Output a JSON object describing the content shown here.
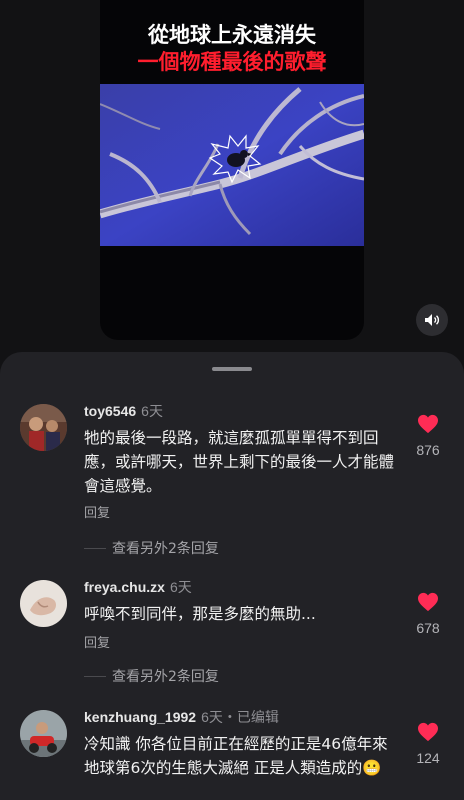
{
  "video": {
    "title_line1": "從地球上永遠消失",
    "title_line2": "一個物種最後的歌聲",
    "title_line2_color": "#ff1e2e",
    "mute_icon": "speaker-mute-icon"
  },
  "comments": [
    {
      "username": "toy6546",
      "time": "6天",
      "text": "牠的最後一段路，就這麼孤孤單單得不到回應，或許哪天，世界上剩下的最後一人才能體會這感覺。",
      "reply_label": "回复",
      "likes": "876",
      "view_replies": "查看另外2条回复"
    },
    {
      "username": "freya.chu.zx",
      "time": "6天",
      "text": "呼喚不到同伴，那是多麼的無助...",
      "reply_label": "回复",
      "likes": "678",
      "view_replies": "查看另外2条回复"
    },
    {
      "username": "kenzhuang_1992",
      "time": "6天・已编辑",
      "text": "冷知識 你各位目前正在經歷的正是46億年來地球第6次的生態大滅絕 正是人類造成的😬",
      "likes": "124"
    }
  ],
  "colors": {
    "like_heart": "#ff2c55",
    "panel_bg": "#222226"
  }
}
